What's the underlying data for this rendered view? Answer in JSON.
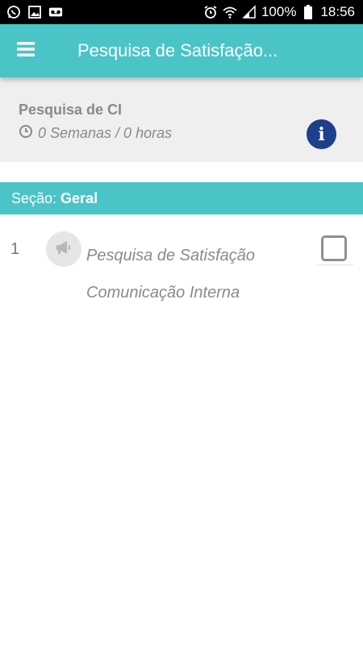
{
  "status_bar": {
    "battery": "100%",
    "time": "18:56"
  },
  "app_bar": {
    "title": "Pesquisa de Satisfação..."
  },
  "info_card": {
    "title": "Pesquisa de CI",
    "duration": "0 Semanas / 0 horas"
  },
  "section": {
    "prefix": "Seção:",
    "name": "Geral"
  },
  "items": [
    {
      "number": "1",
      "line1": "Pesquisa de Satisfação",
      "line2": "Comunicação Interna",
      "checked": false
    }
  ],
  "colors": {
    "primary": "#4bc4c8",
    "info": "#1e3f8c",
    "text_muted": "#8a8a8a"
  }
}
